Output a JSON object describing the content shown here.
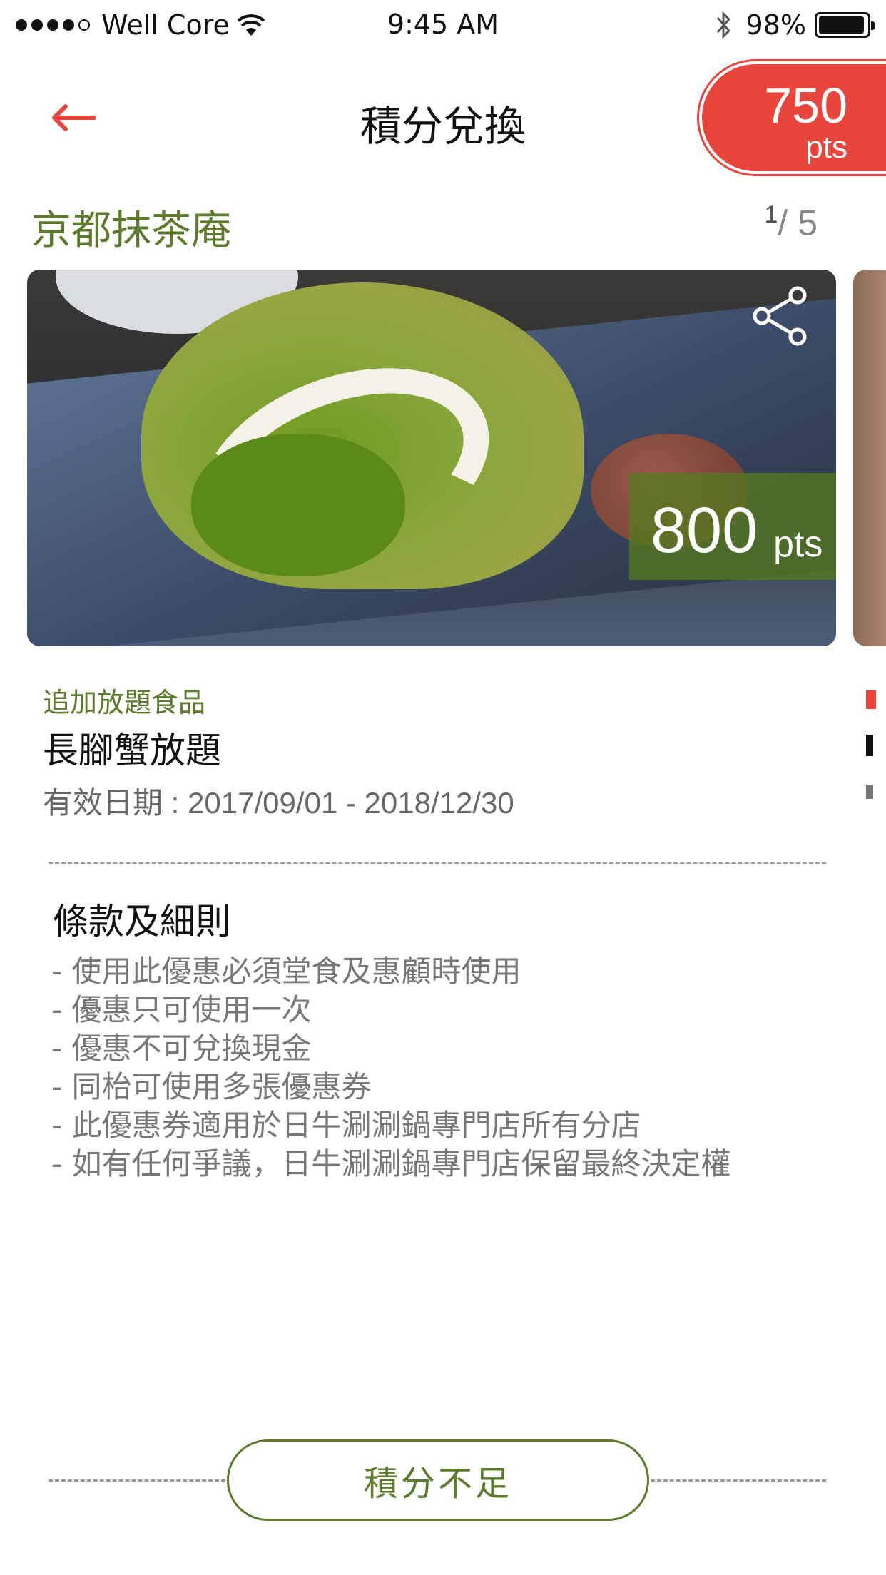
{
  "status_bar": {
    "carrier": "Well Core",
    "time": "9:45 AM",
    "battery_percent": "98%",
    "signal_bars_filled": 4,
    "signal_bars_total": 5
  },
  "nav": {
    "title": "積分兌換",
    "back_icon": "arrow-left-icon",
    "points_value": "750",
    "points_unit": "pts"
  },
  "store": {
    "name": "京都抹茶庵",
    "page_current": "1",
    "page_total": "/ 5"
  },
  "card": {
    "price_value": "800",
    "price_unit": "pts",
    "share_icon": "share-icon"
  },
  "item": {
    "category": "追加放題食品",
    "title": "長腳蟹放題",
    "validity": "有效日期 : 2017/09/01 - 2018/12/30"
  },
  "terms": {
    "title": "條款及細則",
    "items": [
      "- 使用此優惠必須堂食及惠顧時使用",
      "- 優惠只可使用一次",
      "- 優惠不可兌換現金",
      "- 同枱可使用多張優惠券",
      "- 此優惠券適用於日牛涮涮鍋專門店所有分店",
      "- 如有任何爭議，日牛涮涮鍋專門店保留最終決定權"
    ]
  },
  "action": {
    "button_label": "積分不足"
  },
  "colors": {
    "accent_red": "#e8453c",
    "brand_green": "#5b7a2a"
  }
}
